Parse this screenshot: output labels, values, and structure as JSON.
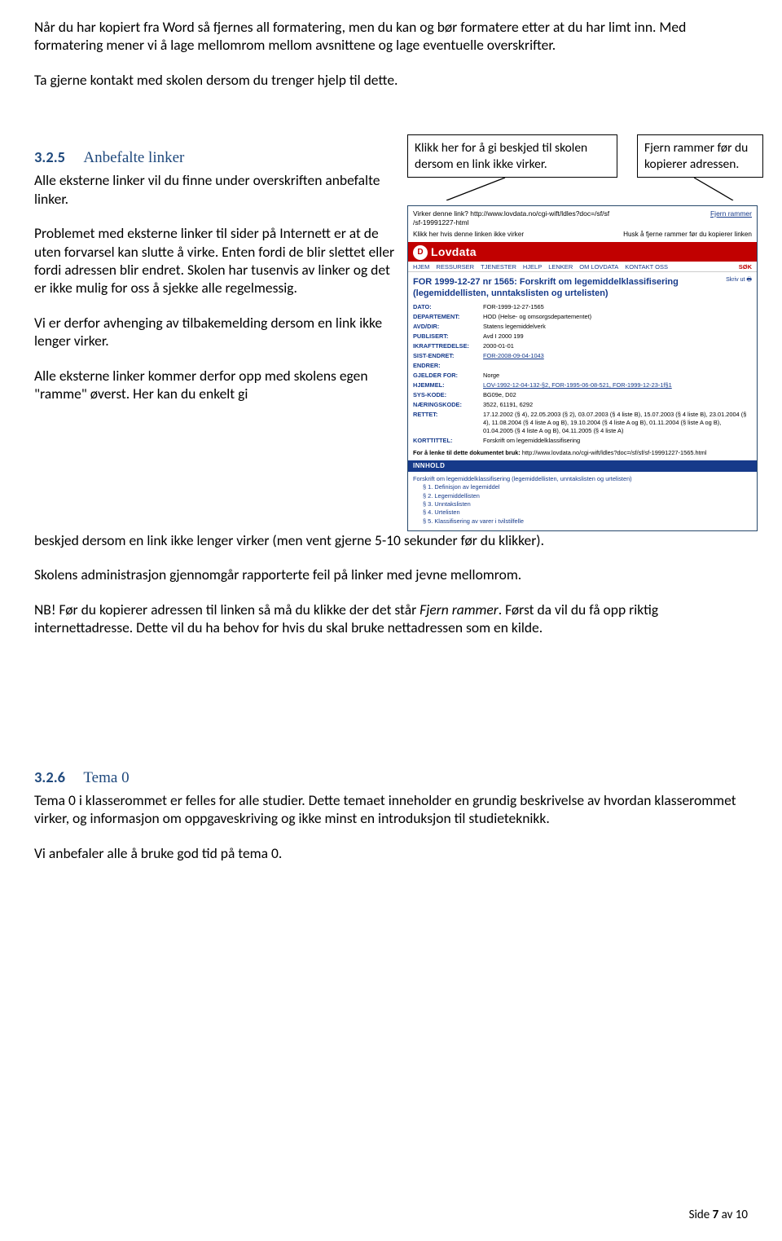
{
  "intro": {
    "p1": "Når du har kopiert fra Word så fjernes all formatering, men du kan og bør formatere etter at du har limt inn. Med formatering mener vi å lage mellomrom mellom avsnittene og lage eventuelle overskrifter.",
    "p2": "Ta gjerne kontakt med skolen dersom du trenger hjelp til dette."
  },
  "callouts": {
    "c1": "Klikk her for å gi beskjed til skolen dersom en link ikke virker.",
    "c2": "Fjern rammer før du kopierer adressen."
  },
  "sec325": {
    "num": "3.2.5",
    "title": "Anbefalte linker",
    "p1": "Alle eksterne linker vil du finne under overskriften anbefalte linker.",
    "p2": "Problemet med eksterne linker til sider på Internett er at de uten forvarsel kan slutte å virke. Enten fordi de blir slettet eller fordi adressen blir endret. Skolen har tusenvis av linker og det er ikke mulig for oss å sjekke alle regelmessig.",
    "p3": "Vi er derfor avhenging av tilbakemelding dersom en link ikke lenger virker.",
    "p4a": "Alle eksterne linker kommer derfor opp med skolens egen \"ramme\" øverst. Her kan du enkelt gi",
    "p4b": "beskjed dersom en link ikke lenger virker (men vent gjerne 5-10 sekunder før du klikker).",
    "p5": "Skolens administrasjon gjennomgår rapporterte feil på linker med jevne mellomrom.",
    "p6_pre": "NB! Før du kopierer adressen til linken så må du klikke der det står ",
    "p6_it": "Fjern rammer",
    "p6_post": ".  Først da vil du få opp riktig internettadresse. Dette vil du ha behov for hvis du skal bruke nettadressen som en kilde."
  },
  "sec326": {
    "num": "3.2.6",
    "title": "Tema 0",
    "p1": "Tema 0 i klasserommet er felles for alle studier. Dette temaet inneholder en grundig beskrivelse av hvordan klasserommet virker, og informasjon om oppgaveskriving og ikke minst en introduksjon til studieteknikk.",
    "p2": "Vi anbefaler alle å bruke god tid på tema 0."
  },
  "frame": {
    "top_prefix": "Virker denne ",
    "top_mid": "? http://www.lovdata.no/cgi-wift/ldles?doc=/sf/sf",
    "top_file": "/sf-19991227-html",
    "top_right": "Fjern rammer",
    "top_line2_left": "Klikk her hvis denne linken ikke virker",
    "top_line2_right": "Husk å fjerne rammer før du kopierer linken",
    "logo_letter": "D",
    "logo_text": "Lovdata",
    "nav": [
      "HJEM",
      "RESSURSER",
      "TJENESTER",
      "HJELP",
      "LENKER",
      "OM LOVDATA",
      "KONTAKT OSS"
    ],
    "nav_search": "SØK",
    "doc_title": "FOR 1999-12-27 nr 1565: Forskrift om legemiddelklassifisering (legemiddellisten, unntakslisten og urtelisten)",
    "doc_side": "Skriv ut",
    "meta": [
      [
        "DATO:",
        "FOR-1999-12-27-1565"
      ],
      [
        "DEPARTEMENT:",
        "HOD (Helse- og omsorgsdepartementet)"
      ],
      [
        "AVD/DIR:",
        "Statens legemiddelverk"
      ],
      [
        "PUBLISERT:",
        "Avd I 2000 199"
      ],
      [
        "IKRAFTTREDELSE:",
        "2000-01-01"
      ],
      [
        "SIST-ENDRET:",
        "FOR-2008-09-04-1043"
      ],
      [
        "ENDRER:",
        ""
      ],
      [
        "GJELDER FOR:",
        "Norge"
      ],
      [
        "HJEMMEL:",
        "LOV-1992-12-04-132-§2, FOR-1995-06-08-521, FOR-1999-12-23-1f§1"
      ],
      [
        "SYS-KODE:",
        "BG09e, D02"
      ],
      [
        "NÆRINGSKODE:",
        "3522, 61191, 6292"
      ],
      [
        "RETTET:",
        "17.12.2002 (§ 4), 22.05.2003 (§ 2), 03.07.2003 (§ 4 liste B), 15.07.2003 (§ 4 liste B), 23.01.2004 (§ 4), 11.08.2004 (§ 4 liste A og B), 19.10.2004 (§ 4 liste A og B), 01.11.2004 (§ liste A og B), 01.04.2005 (§ 4 liste A og B), 04.11.2005 (§ 4 liste A)"
      ],
      [
        "KORTTITTEL:",
        "Forskrift om legemiddelklassifisering"
      ]
    ],
    "ref_label": "For å lenke til dette dokumentet bruk:",
    "ref_url": "http://www.lovdata.no/cgi-wift/ldles?doc=/sf/sf/sf-19991227-1565.html",
    "innhold": "INNHOLD",
    "toc": [
      "Forskrift om legemiddelklassifisering (legemiddellisten, unntakslisten og urtelisten)",
      "§ 1. Definisjon av legemiddel",
      "§ 2. Legemiddellisten",
      "§ 3. Unntakslisten",
      "§ 4. Urtelisten",
      "§ 5. Klassifisering av varer i tvilstilfelle"
    ]
  },
  "footer": {
    "prefix": "Side ",
    "page": "7",
    "mid": " av ",
    "total": "10"
  }
}
